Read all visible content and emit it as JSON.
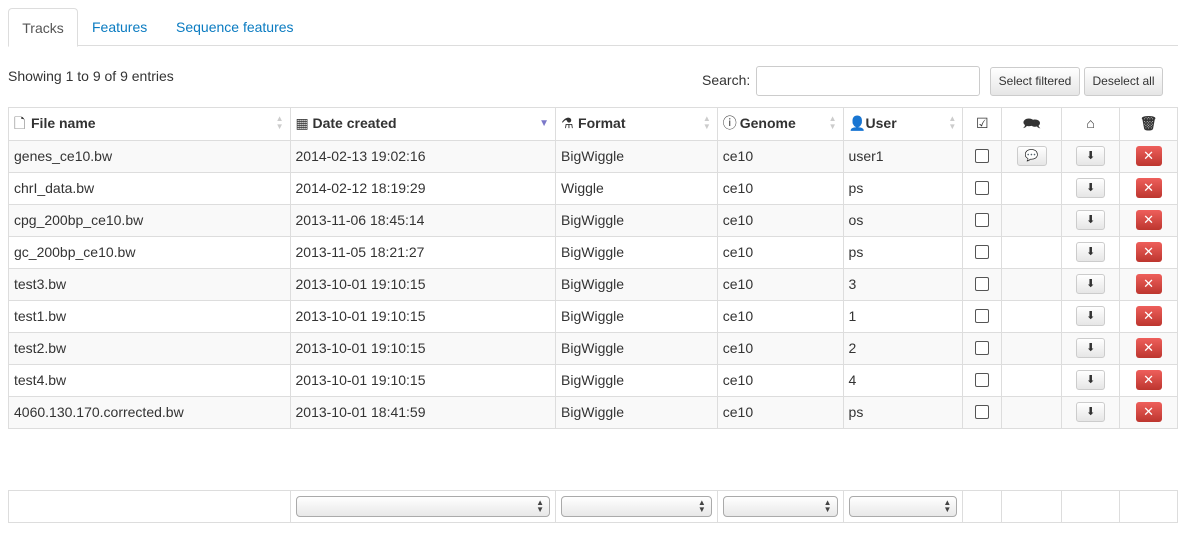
{
  "tabs": [
    {
      "label": "Tracks",
      "active": true
    },
    {
      "label": "Features",
      "active": false
    },
    {
      "label": "Sequence features",
      "active": false
    }
  ],
  "info_text": "Showing 1 to 9 of 9 entries",
  "search": {
    "label": "Search:",
    "value": "",
    "placeholder": ""
  },
  "buttons": {
    "select_filtered": "Select filtered",
    "deselect_all": "Deselect all"
  },
  "columns": {
    "file_name": "File name",
    "date_created": "Date created",
    "format": "Format",
    "genome": "Genome",
    "user": "User"
  },
  "icons": {
    "file": "file-icon",
    "calendar": "calendar-icon",
    "flask": "flask-icon",
    "info": "info-icon",
    "user": "user-icon",
    "check": "checkbox-check-icon",
    "comments": "comments-icon",
    "hdd": "drive-icon",
    "trash": "trash-icon",
    "download": "download-icon",
    "remove": "remove-icon"
  },
  "sort": {
    "column": "date_created",
    "direction": "desc"
  },
  "rows": [
    {
      "file": "genes_ce10.bw",
      "date": "2014-02-13 19:02:16",
      "format": "BigWiggle",
      "genome": "ce10",
      "user": "user1",
      "comment": true
    },
    {
      "file": "chrI_data.bw",
      "date": "2014-02-12 18:19:29",
      "format": "Wiggle",
      "genome": "ce10",
      "user": "ps",
      "comment": false
    },
    {
      "file": "cpg_200bp_ce10.bw",
      "date": "2013-11-06 18:45:14",
      "format": "BigWiggle",
      "genome": "ce10",
      "user": "os",
      "comment": false
    },
    {
      "file": "gc_200bp_ce10.bw",
      "date": "2013-11-05 18:21:27",
      "format": "BigWiggle",
      "genome": "ce10",
      "user": "ps",
      "comment": false
    },
    {
      "file": "test3.bw",
      "date": "2013-10-01 19:10:15",
      "format": "BigWiggle",
      "genome": "ce10",
      "user": "3",
      "comment": false
    },
    {
      "file": "test1.bw",
      "date": "2013-10-01 19:10:15",
      "format": "BigWiggle",
      "genome": "ce10",
      "user": "1",
      "comment": false
    },
    {
      "file": "test2.bw",
      "date": "2013-10-01 19:10:15",
      "format": "BigWiggle",
      "genome": "ce10",
      "user": "2",
      "comment": false
    },
    {
      "file": "test4.bw",
      "date": "2013-10-01 19:10:15",
      "format": "BigWiggle",
      "genome": "ce10",
      "user": "4",
      "comment": false
    },
    {
      "file": "4060.130.170.corrected.bw",
      "date": "2013-10-01 18:41:59",
      "format": "BigWiggle",
      "genome": "ce10",
      "user": "ps",
      "comment": false
    }
  ],
  "filters": {
    "date_created": "",
    "format": "",
    "genome": "",
    "user": ""
  }
}
